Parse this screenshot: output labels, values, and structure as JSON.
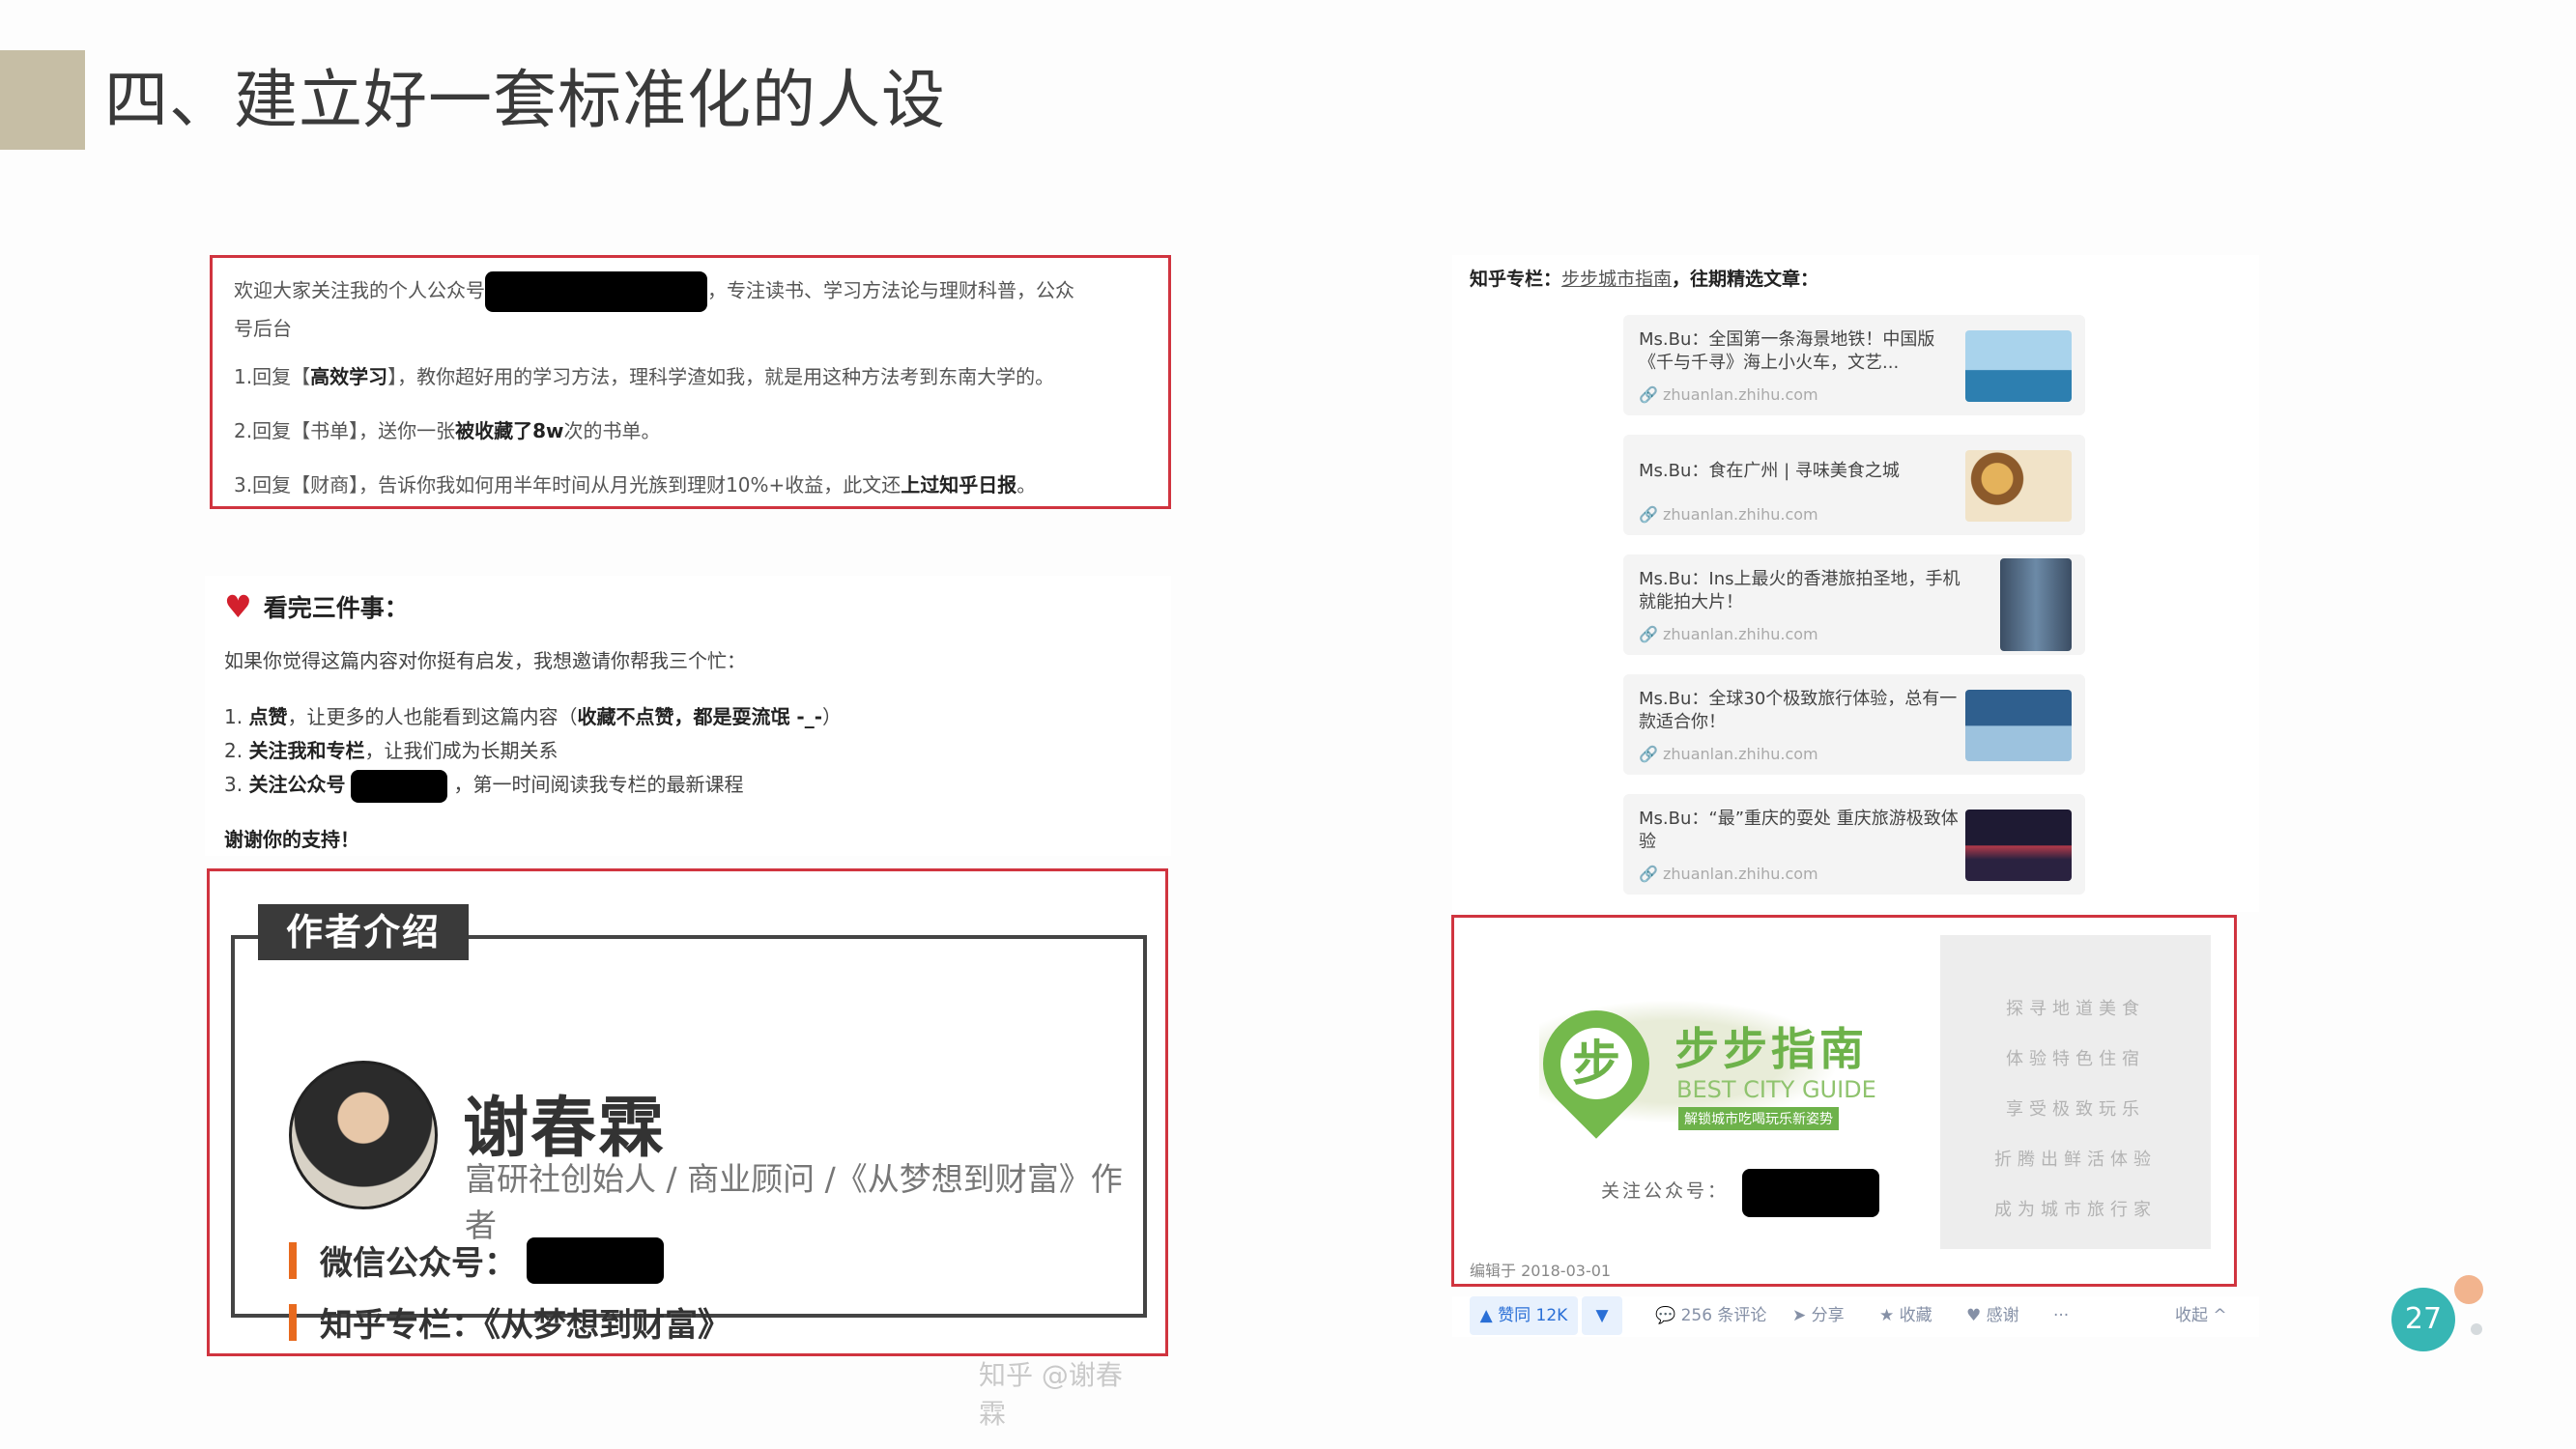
{
  "title": "四、建立好一套标准化的人设",
  "page_number": "27",
  "box1": {
    "line1_a": "欢迎大家关注我的个人公众号",
    "line1_b": "，专注读书、学习方法论与理财科普，公众",
    "line1_c": "号后台",
    "line2_a": "1.回复【",
    "line2_b": "高效学习",
    "line2_c": "】，教你超好用的学习方法，理科学渣如我，就是用这种方法考到东南大学的。",
    "line3_a": "2.回复【书单】，送你一张",
    "line3_b": "被收藏了8w",
    "line3_c": "次的书单。",
    "line4_a": "3.回复【财商】，告诉你我如何用半年时间从月光族到理财10%+收益，此文还",
    "line4_b": "上过知乎日报",
    "line4_c": "。"
  },
  "three": {
    "heading": "看完三件事：",
    "intro": "如果你觉得这篇内容对你挺有启发，我想邀请你帮我三个忙：",
    "i1_a": "1. ",
    "i1_b": "点赞",
    "i1_c": "，让更多的人也能看到这篇内容（",
    "i1_d": "收藏不点赞，都是耍流氓 -_-",
    "i1_e": "）",
    "i2_a": "2. ",
    "i2_b": "关注我和专栏",
    "i2_c": "，让我们成为长期关系",
    "i3_a": "3. ",
    "i3_b": "关注公众号",
    "i3_c": "，第一时间阅读我专栏的最新课程",
    "thanks": "谢谢你的支持！"
  },
  "author": {
    "tag": "作者介绍",
    "name": "谢春霖",
    "desc": "富研社创始人 / 商业顾问 /《从梦想到财富》作者",
    "wechat_label": "微信公众号：",
    "zhihu_label": "知乎专栏：《从梦想到财富》",
    "watermark": "知乎 @谢春霖"
  },
  "zhuanlan": {
    "head_a": "知乎专栏：",
    "head_b": "步步城市指南",
    "head_c": "，往期精选文章：",
    "articles": [
      {
        "title": "Ms.Bu：全国第一条海景地铁！中国版《千与千寻》海上小火车，文艺...",
        "src": "zhuanlan.zhihu.com",
        "color": "#7fb6d8"
      },
      {
        "title": "Ms.Bu：食在广州 | 寻味美食之城",
        "src": "zhuanlan.zhihu.com",
        "color": "#c08a4e"
      },
      {
        "title": "Ms.Bu：Ins上最火的香港旅拍圣地，手机就能拍大片！",
        "src": "zhuanlan.zhihu.com",
        "color": "#4f6d8c"
      },
      {
        "title": "Ms.Bu：全球30个极致旅行体验，总有一款适合你！",
        "src": "zhuanlan.zhihu.com",
        "color": "#3e6f9a"
      },
      {
        "title": "Ms.Bu：“最”重庆的耍处 重庆旅游极致体验",
        "src": "zhuanlan.zhihu.com",
        "color": "#2b2440"
      }
    ]
  },
  "guide": {
    "logo_char": "步",
    "logo_cn": "步步指南",
    "logo_en": "BEST CITY GUIDE",
    "logo_tag": "解锁城市吃喝玩乐新姿势",
    "follow": "关注公众号：",
    "side": [
      "探寻地道美食",
      "体验特色住宿",
      "享受极致玩乐",
      "折腾出鲜活体验",
      "成为城市旅行家"
    ],
    "edit_date": "编辑于 2018-03-01"
  },
  "actions": {
    "vote": "▲ 赞同 12K",
    "down": "▼",
    "comments": "💬 256 条评论",
    "share": "➤ 分享",
    "fav": "★ 收藏",
    "thanks": "♥ 感谢",
    "more": "···",
    "collapse": "收起 ^"
  }
}
